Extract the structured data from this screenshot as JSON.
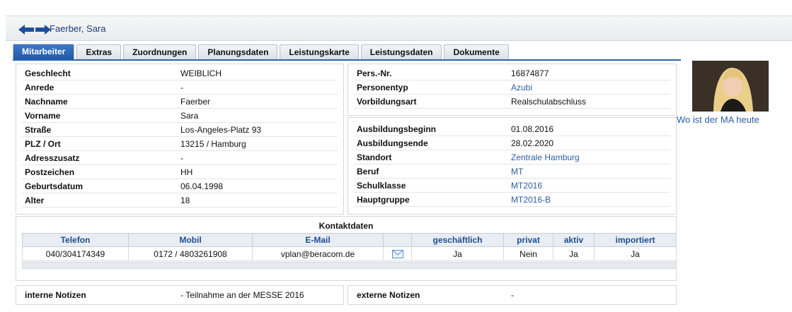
{
  "header": {
    "person_name": "Faerber, Sara"
  },
  "tabs": [
    "Mitarbeiter",
    "Extras",
    "Zuordnungen",
    "Planungsdaten",
    "Leistungskarte",
    "Leistungsdaten",
    "Dokumente"
  ],
  "personal": {
    "rows": [
      {
        "label": "Geschlecht",
        "value": "WEIBLICH"
      },
      {
        "label": "Anrede",
        "value": "-"
      },
      {
        "label": "Nachname",
        "value": "Faerber"
      },
      {
        "label": "Vorname",
        "value": "Sara"
      },
      {
        "label": "Straße",
        "value": "Los-Angeles-Platz 93"
      },
      {
        "label": "PLZ / Ort",
        "value": "13215 / Hamburg"
      },
      {
        "label": "Adresszusatz",
        "value": "-"
      },
      {
        "label": "Postzeichen",
        "value": "HH"
      },
      {
        "label": "Geburtsdatum",
        "value": "06.04.1998"
      },
      {
        "label": "Alter",
        "value": "18"
      }
    ]
  },
  "person_info": {
    "rows": [
      {
        "label": "Pers.-Nr.",
        "value": "16874877"
      },
      {
        "label": "Personentyp",
        "value": "Azubi"
      },
      {
        "label": "Vorbildungsart",
        "value": "Realschulabschluss"
      }
    ]
  },
  "training": {
    "rows": [
      {
        "label": "Ausbildungsbeginn",
        "value": "01.08.2016"
      },
      {
        "label": "Ausbildungsende",
        "value": "28.02.2020"
      },
      {
        "label": "Standort",
        "value": "Zentrale Hamburg"
      },
      {
        "label": "Beruf",
        "value": "MT"
      },
      {
        "label": "Schulklasse",
        "value": "MT2016"
      },
      {
        "label": "Hauptgruppe",
        "value": "MT2016-B"
      }
    ]
  },
  "contact": {
    "title": "Kontaktdaten",
    "headers": [
      "Telefon",
      "Mobil",
      "E-Mail",
      "",
      "geschäftlich",
      "privat",
      "aktiv",
      "importiert"
    ],
    "row": {
      "telefon": "040/304174349",
      "mobil": "0172 / 4803261908",
      "email": "vplan@beracom.de",
      "geschaeftlich": "Ja",
      "privat": "Nein",
      "aktiv": "Ja",
      "importiert": "Ja"
    }
  },
  "notes": {
    "internal_label": "interne Notizen",
    "internal_value": "- Teilnahme an der MESSE 2016",
    "external_label": "externe Notizen",
    "external_value": "-"
  },
  "photo_caption": "Wo ist der MA heute",
  "colors": {
    "accent": "#2a63b0",
    "link": "#2b5ea7",
    "header_cell": "#e8edf3"
  },
  "icons": [
    "arrow-left-icon",
    "arrow-right-icon",
    "mail-icon",
    "employee-photo"
  ]
}
